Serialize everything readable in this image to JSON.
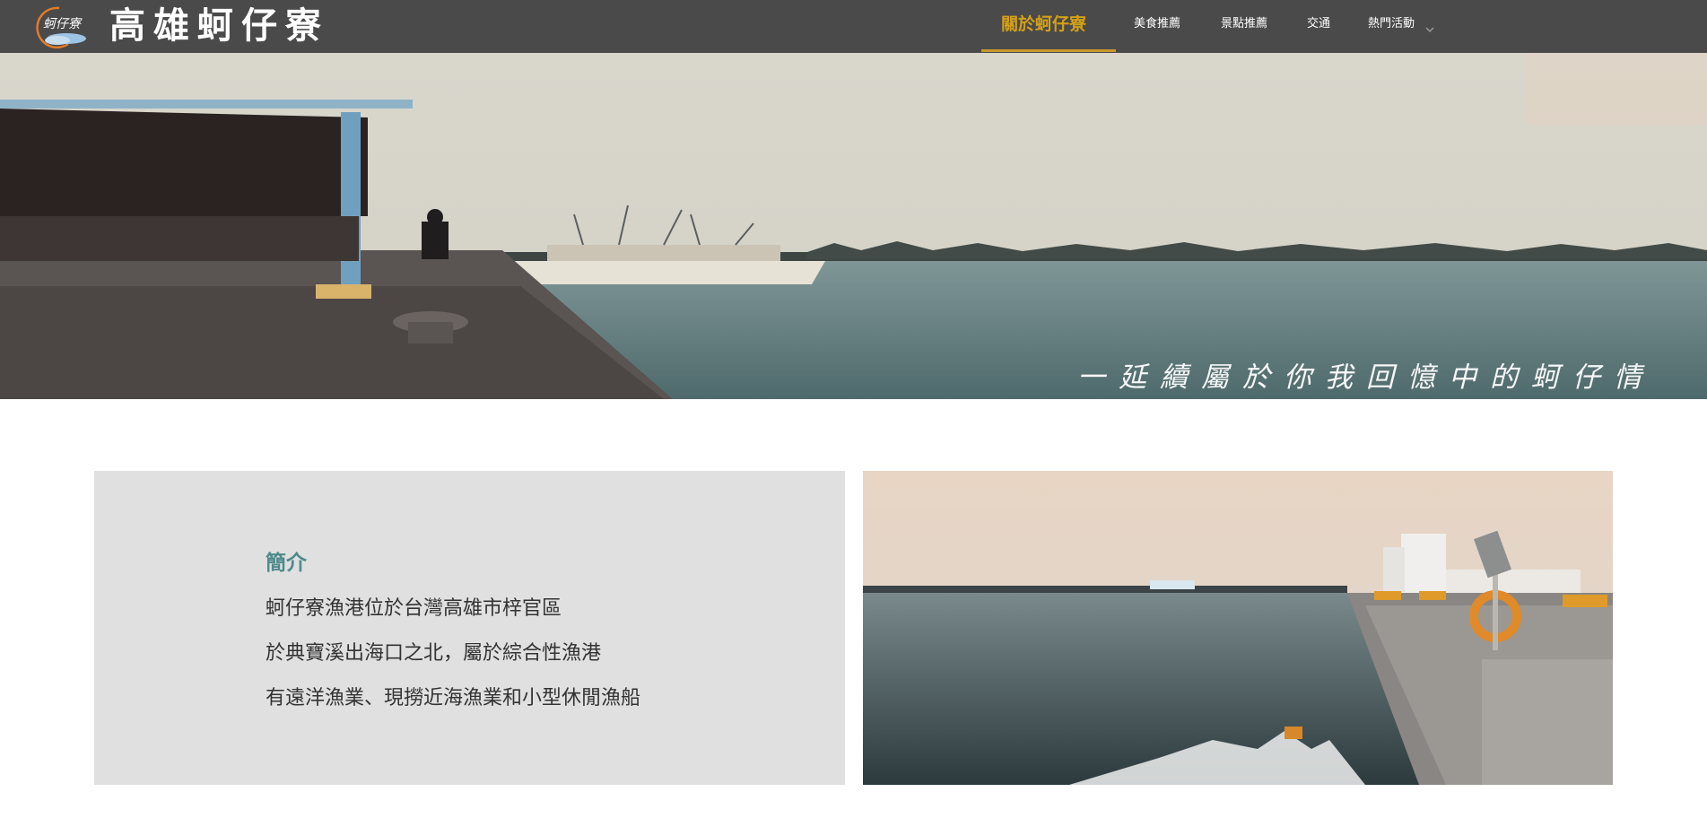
{
  "header": {
    "logo_text": "蚵仔寮",
    "site_title": "高雄蚵仔寮",
    "nav": [
      {
        "label": "關於蚵仔寮",
        "active": true
      },
      {
        "label": "美食推薦",
        "active": false
      },
      {
        "label": "景點推薦",
        "active": false
      },
      {
        "label": "交通",
        "active": false
      },
      {
        "label": "熱門活動",
        "active": false,
        "has_dropdown": true
      }
    ]
  },
  "hero": {
    "caption": "一延續屬於你我回憶中的蚵仔情"
  },
  "intro": {
    "title": "簡介",
    "lines": [
      "蚵仔寮漁港位於台灣高雄市梓官區",
      "於典寶溪出海口之北，屬於綜合性漁港",
      "有遠洋漁業、現撈近海漁業和小型休閒漁船"
    ]
  },
  "colors": {
    "header_bg": "#4a4a4a",
    "nav_active": "#d4a017",
    "intro_title": "#4e8a8b",
    "intro_bg": "#e0e0e0"
  }
}
